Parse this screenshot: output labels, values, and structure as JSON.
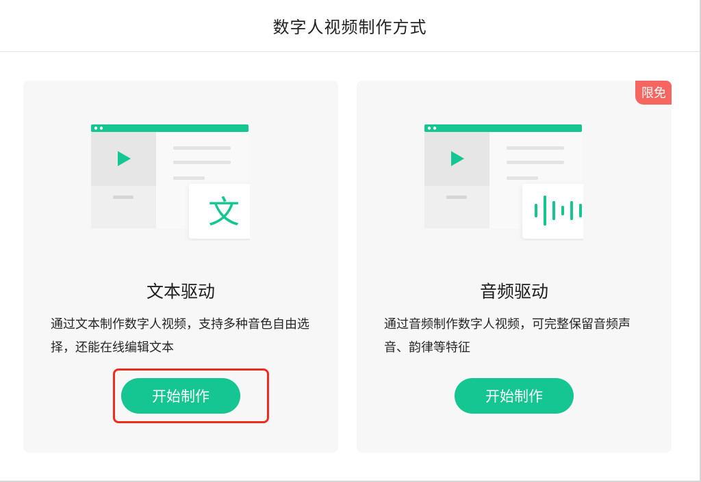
{
  "dialog": {
    "title": "数字人视频制作方式"
  },
  "cards": [
    {
      "title": "文本驱动",
      "description": "通过文本制作数字人视频，支持多种音色自由选择，还能在线编辑文本",
      "button_label": "开始制作",
      "illustration_glyph": "文",
      "illustration_icon": "text-glyph-icon",
      "highlighted": true
    },
    {
      "title": "音频驱动",
      "description": "通过音频制作数字人视频，可完整保留音频声音、韵律等特征",
      "button_label": "开始制作",
      "badge": "限免",
      "illustration_icon": "audio-waveform-icon"
    }
  ],
  "colors": {
    "accent": "#15c592",
    "badge": "#f4665f",
    "highlight": "#ee2b1c",
    "card_bg": "#f7f7f7"
  }
}
